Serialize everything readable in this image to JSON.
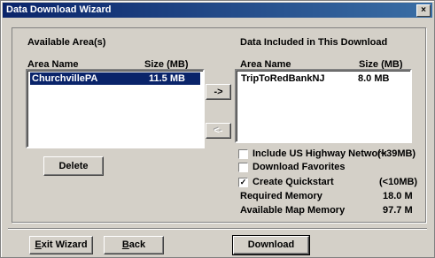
{
  "window": {
    "title": "Data Download Wizard",
    "close_glyph": "×"
  },
  "available": {
    "heading": "Available Area(s)",
    "col_name": "Area Name",
    "col_size": "Size (MB)",
    "rows": [
      {
        "name": "ChurchvillePA",
        "size": "11.5 MB",
        "selected": true
      }
    ]
  },
  "included": {
    "heading": "Data Included in This Download",
    "col_name": "Area Name",
    "col_size": "Size (MB)",
    "rows": [
      {
        "name": "TripToRedBankNJ",
        "size": "8.0 MB"
      }
    ]
  },
  "buttons": {
    "add": "->",
    "remove": "<-",
    "delete": "Delete",
    "exit_first": "E",
    "exit_rest": "xit Wizard",
    "back_first": "B",
    "back_rest": "ack",
    "download": "Download"
  },
  "options": {
    "highway_label": "Include US Highway Network",
    "highway_size": "(~39MB)",
    "highway_checked": false,
    "favorites_label": "Download Favorites",
    "favorites_checked": false,
    "quickstart_label": "Create Quickstart",
    "quickstart_size": "(<10MB)",
    "quickstart_checked": true,
    "check_glyph": "✓"
  },
  "memory": {
    "required_label": "Required Memory",
    "required_value": "18.0 M",
    "available_label": "Available Map Memory",
    "available_value": "97.7 M"
  },
  "colors": {
    "selection": "#0a246a",
    "titlebar": "#0a246a"
  }
}
